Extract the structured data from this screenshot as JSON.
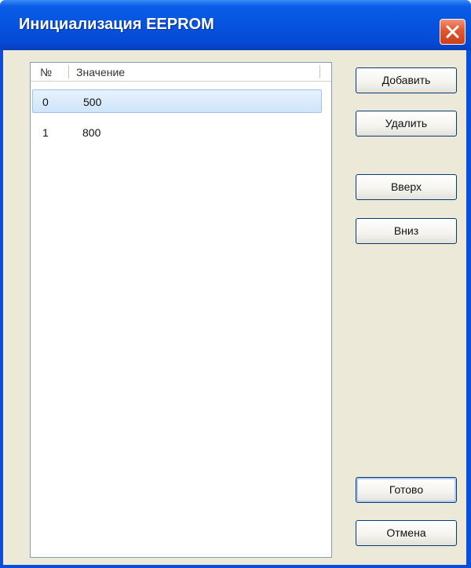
{
  "window": {
    "title": "Инициализация EEPROM"
  },
  "list": {
    "columns": [
      "№",
      "Значение"
    ],
    "rows": [
      {
        "index": "0",
        "value": "500",
        "selected": true
      },
      {
        "index": "1",
        "value": "800",
        "selected": false
      }
    ]
  },
  "buttons": {
    "add": "Добавить",
    "delete": "Удалить",
    "up": "Вверх",
    "down": "Вниз",
    "done": "Готово",
    "cancel": "Отмена"
  },
  "colors": {
    "titlebar": "#0553e0",
    "dialog_face": "#ece9d8",
    "close_button": "#e2572f",
    "selection": "#cfe4fb"
  },
  "icons": {
    "close": "close-icon"
  }
}
